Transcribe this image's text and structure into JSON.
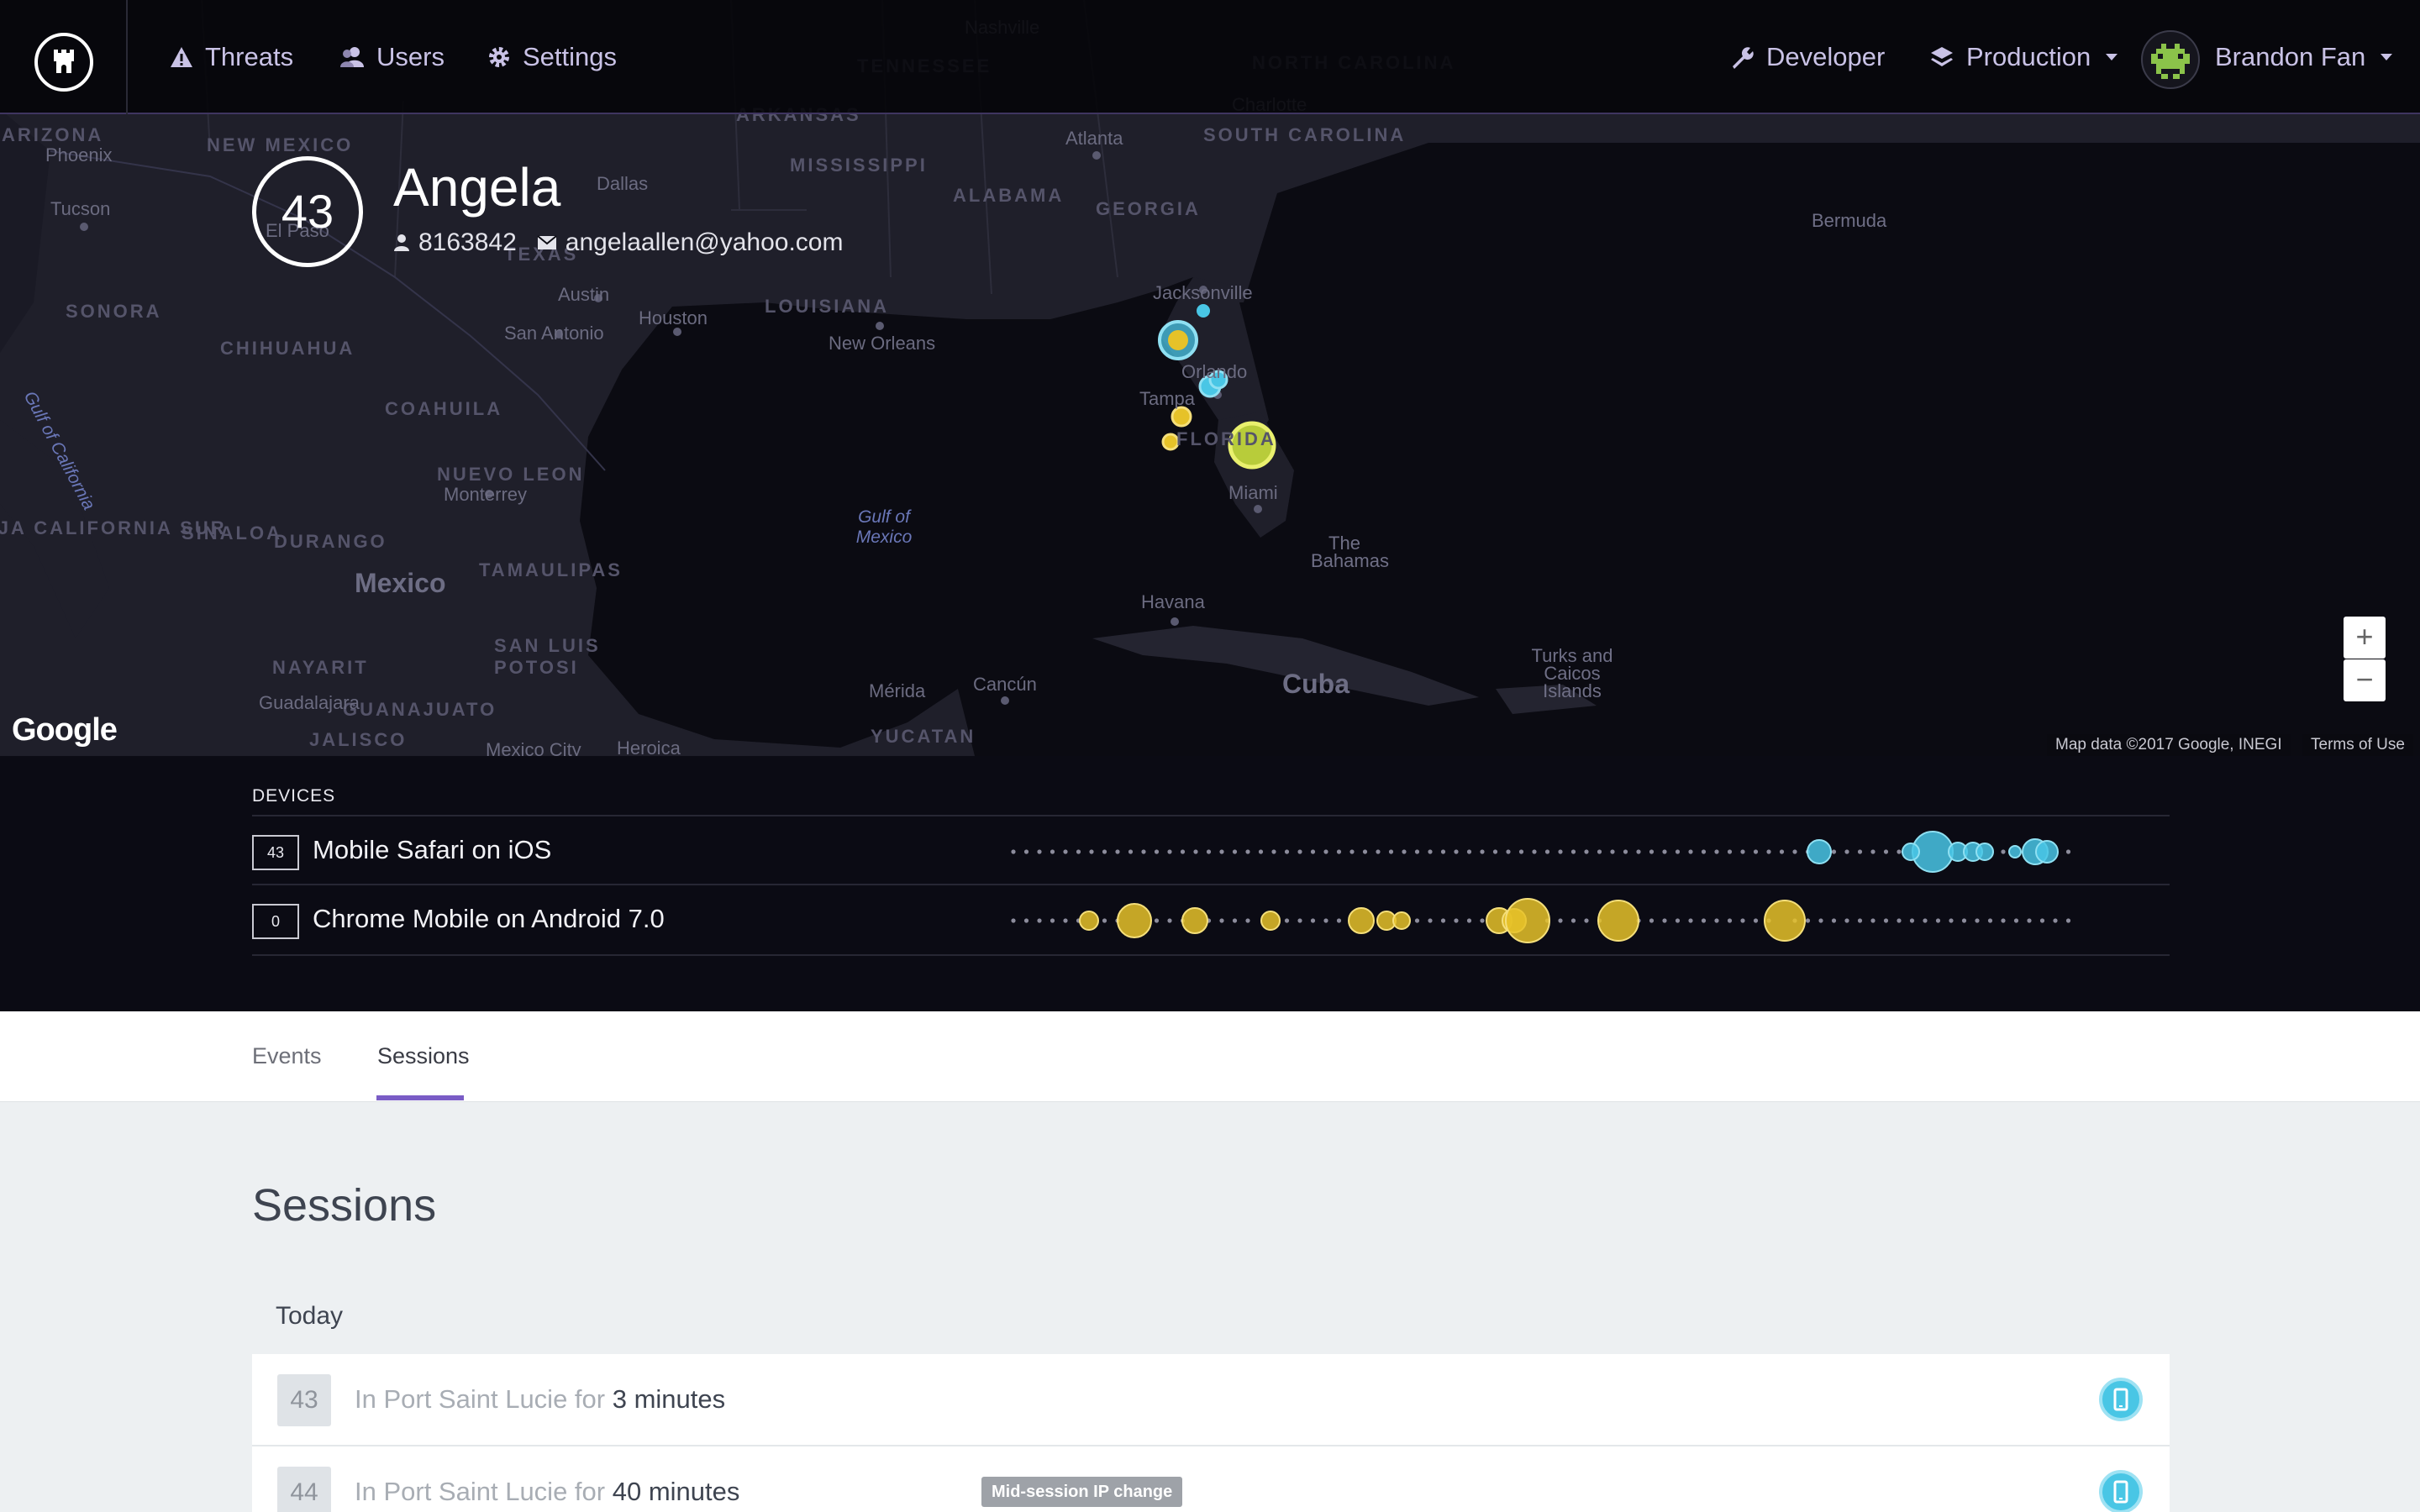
{
  "map": {
    "state_labels": [
      "ARIZONA",
      "NEW MEXICO",
      "MISSISSIPPI",
      "ALABAMA",
      "GEORGIA",
      "SOUTH CAROLINA",
      "NORTH CAROLINA",
      "TENNESSEE",
      "ARKANSAS",
      "LOUISIANA",
      "TEXAS",
      "FLORIDA",
      "SONORA",
      "CHIHUAHUA",
      "COAHUILA",
      "NUEVO LEON",
      "SINALOA",
      "DURANGO",
      "TAMAULIPAS",
      "SAN LUIS POTOSI",
      "NAYARIT",
      "GUANAJUATO",
      "JALISCO",
      "BAJA CALIFORNIA SUR",
      "YUCATAN"
    ],
    "city_labels": [
      "Phoenix",
      "Tucson",
      "El Paso",
      "Dallas",
      "Austin",
      "San Antonio",
      "Houston",
      "New Orleans",
      "Atlanta",
      "Charlotte",
      "Nashville",
      "Jacksonville",
      "Orlando",
      "Tampa",
      "Miami",
      "Havana",
      "Monterrey",
      "Guadalajara",
      "Mexico City",
      "Heroica",
      "Mérida",
      "Cancún"
    ],
    "country_labels": [
      "Mexico",
      "Cuba"
    ],
    "water_labels": [
      "Gulf of Mexico",
      "Gulf of California"
    ],
    "island_labels": [
      "Bermuda",
      "The Bahamas",
      "Turks and Caicos Islands"
    ],
    "attribution": "Map data ©2017 Google, INEGI",
    "terms": "Terms of Use",
    "logo_text": "Google",
    "zoom_in": "+",
    "zoom_out": "−"
  },
  "navbar": {
    "threats": "Threats",
    "users": "Users",
    "settings": "Settings",
    "developer": "Developer",
    "environment": "Production",
    "user_name": "Brandon Fan"
  },
  "profile": {
    "score": "43",
    "name": "Angela",
    "user_id": "8163842",
    "email": "angelaallen@yahoo.com"
  },
  "devices": {
    "title": "DEVICES",
    "rows": [
      {
        "badge": "43",
        "name": "Mobile Safari on iOS",
        "color": "#49c6e5"
      },
      {
        "badge": "0",
        "name": "Chrome Mobile on Android 7.0",
        "color": "#e6c229"
      }
    ]
  },
  "tabs": {
    "events": "Events",
    "sessions": "Sessions",
    "active": "Sessions"
  },
  "sessions": {
    "title": "Sessions",
    "day": "Today",
    "rows": [
      {
        "number": "43",
        "prefix": "In Port Saint Lucie for",
        "duration": "3 minutes",
        "tag": ""
      },
      {
        "number": "44",
        "prefix": "In Port Saint Lucie for",
        "duration": "40 minutes",
        "tag": "Mid-session IP change"
      }
    ]
  },
  "colors": {
    "accent": "#7a5cc6",
    "ios": "#49c6e5",
    "android": "#e6c229",
    "nav_bg": "#040408"
  }
}
